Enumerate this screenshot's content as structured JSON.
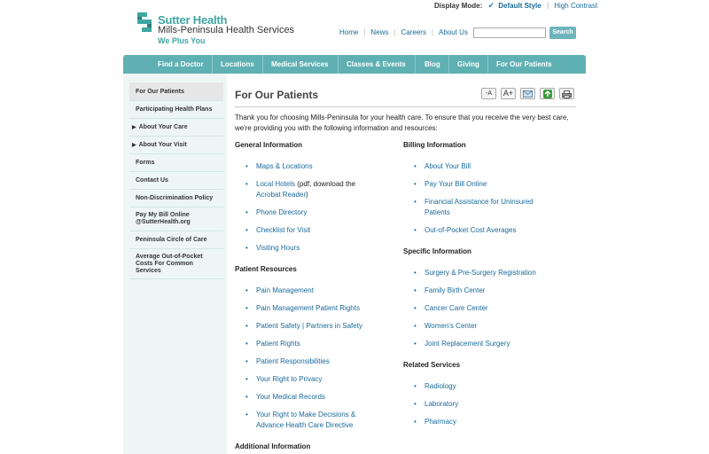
{
  "utility": {
    "display_mode_label": "Display Mode:",
    "default_style": "Default Style",
    "high_contrast": "High Contrast"
  },
  "logo": {
    "line1": "Sutter Health",
    "line2": "Mills-Peninsula Health Services",
    "tagline": "We Plus You",
    "icon": "sutter-s-logo-icon"
  },
  "header": {
    "links": [
      "Home",
      "News",
      "Careers",
      "About Us"
    ],
    "search_placeholder": "",
    "search_button": "Search"
  },
  "nav": [
    "Find a Doctor",
    "Locations",
    "Medical Services",
    "Classes & Events",
    "Blog",
    "Giving",
    "For Our Patients"
  ],
  "sidebar": [
    {
      "label": "For Our Patients",
      "arrow": false,
      "active": true
    },
    {
      "label": "Participating Health Plans",
      "arrow": false
    },
    {
      "label": "About Your Care",
      "arrow": true
    },
    {
      "label": "About Your Visit",
      "arrow": true
    },
    {
      "label": "Forms",
      "arrow": false
    },
    {
      "label": "Contact Us",
      "arrow": false
    },
    {
      "label": "Non-Discrimination Policy",
      "arrow": false
    },
    {
      "label": "Pay My Bill Online @SutterHealth.org",
      "arrow": false
    },
    {
      "label": "Peninsula Circle of Care",
      "arrow": false
    },
    {
      "label": "Average Out-of-Pocket Costs For Common Services",
      "arrow": false
    }
  ],
  "page": {
    "title": "For Our Patients",
    "tools": [
      "-A",
      "A+",
      "email-icon",
      "share-icon",
      "print-icon"
    ],
    "intro": "Thank you for choosing Mills-Peninsula for your health care. To ensure that you receive the very best care, we're providing you with the following information and resources:"
  },
  "sections": {
    "general": {
      "title": "General Information",
      "items": [
        "Maps & Locations",
        "Local Hotels",
        "(pdf, download the",
        "Acrobat Reader",
        ")",
        "Phone Directory",
        "Checklist for Visit",
        "Visiting Hours"
      ]
    },
    "patient_resources": {
      "title": "Patient Resources",
      "items": [
        "Pain Management",
        "Pain Management Patient Rights",
        "Patient Safety | Partners in Safety",
        "Patient Rights",
        "Patient Responsibilities",
        "Your Right to Privacy",
        "Your Medical Records",
        "Your Right to Make Decisions &",
        "Advance Health Care Directive"
      ]
    },
    "additional": {
      "title": "Additional Information"
    },
    "billing": {
      "title": "Billing Information",
      "items": [
        "About Your Bill",
        "Pay Your Bill Online",
        "Financial Assistance for Uninsured",
        "Patients",
        "Out-of-Pocket Cost Averages"
      ]
    },
    "specific": {
      "title": "Specific Information",
      "items": [
        "Surgery & Pre-Surgery Registration",
        "Family Birth Center",
        "Cancer Care Center",
        "Women's Center",
        "Joint Replacement Surgery"
      ]
    },
    "related": {
      "title": "Related Services",
      "items": [
        "Radiology",
        "Laboratory",
        "Pharmacy"
      ]
    }
  }
}
